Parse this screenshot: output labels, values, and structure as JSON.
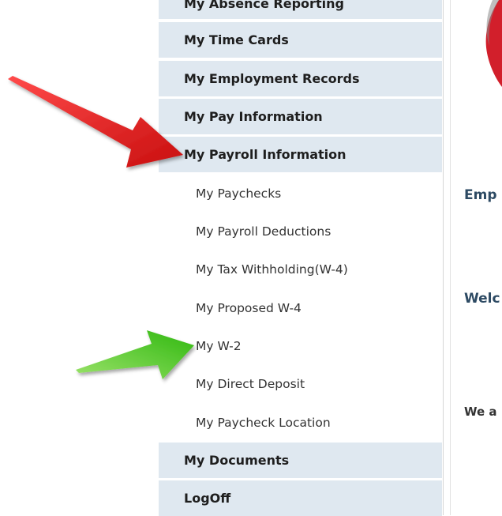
{
  "sidebar": {
    "partial_top_label": "My Absence Reporting",
    "menu_items": [
      {
        "label": "My Time Cards"
      },
      {
        "label": "My Employment Records"
      },
      {
        "label": "My Pay Information"
      },
      {
        "label": "My Payroll Information"
      }
    ],
    "sub_items": [
      {
        "label": "My Paychecks"
      },
      {
        "label": "My Payroll Deductions"
      },
      {
        "label": "My Tax Withholding(W-4)"
      },
      {
        "label": "My Proposed W-4"
      },
      {
        "label": "My W-2"
      },
      {
        "label": "My Direct Deposit"
      },
      {
        "label": "My Paycheck Location"
      }
    ],
    "bottom_items": [
      {
        "label": "My Documents"
      },
      {
        "label": "LogOff"
      }
    ]
  },
  "content": {
    "heading_1": "Emp",
    "heading_2": "Welc",
    "text_1": "We a"
  },
  "colors": {
    "menu_bg": "#dfe8f0",
    "red_arrow": "#e01b1b",
    "green_arrow": "#5cd12a"
  }
}
